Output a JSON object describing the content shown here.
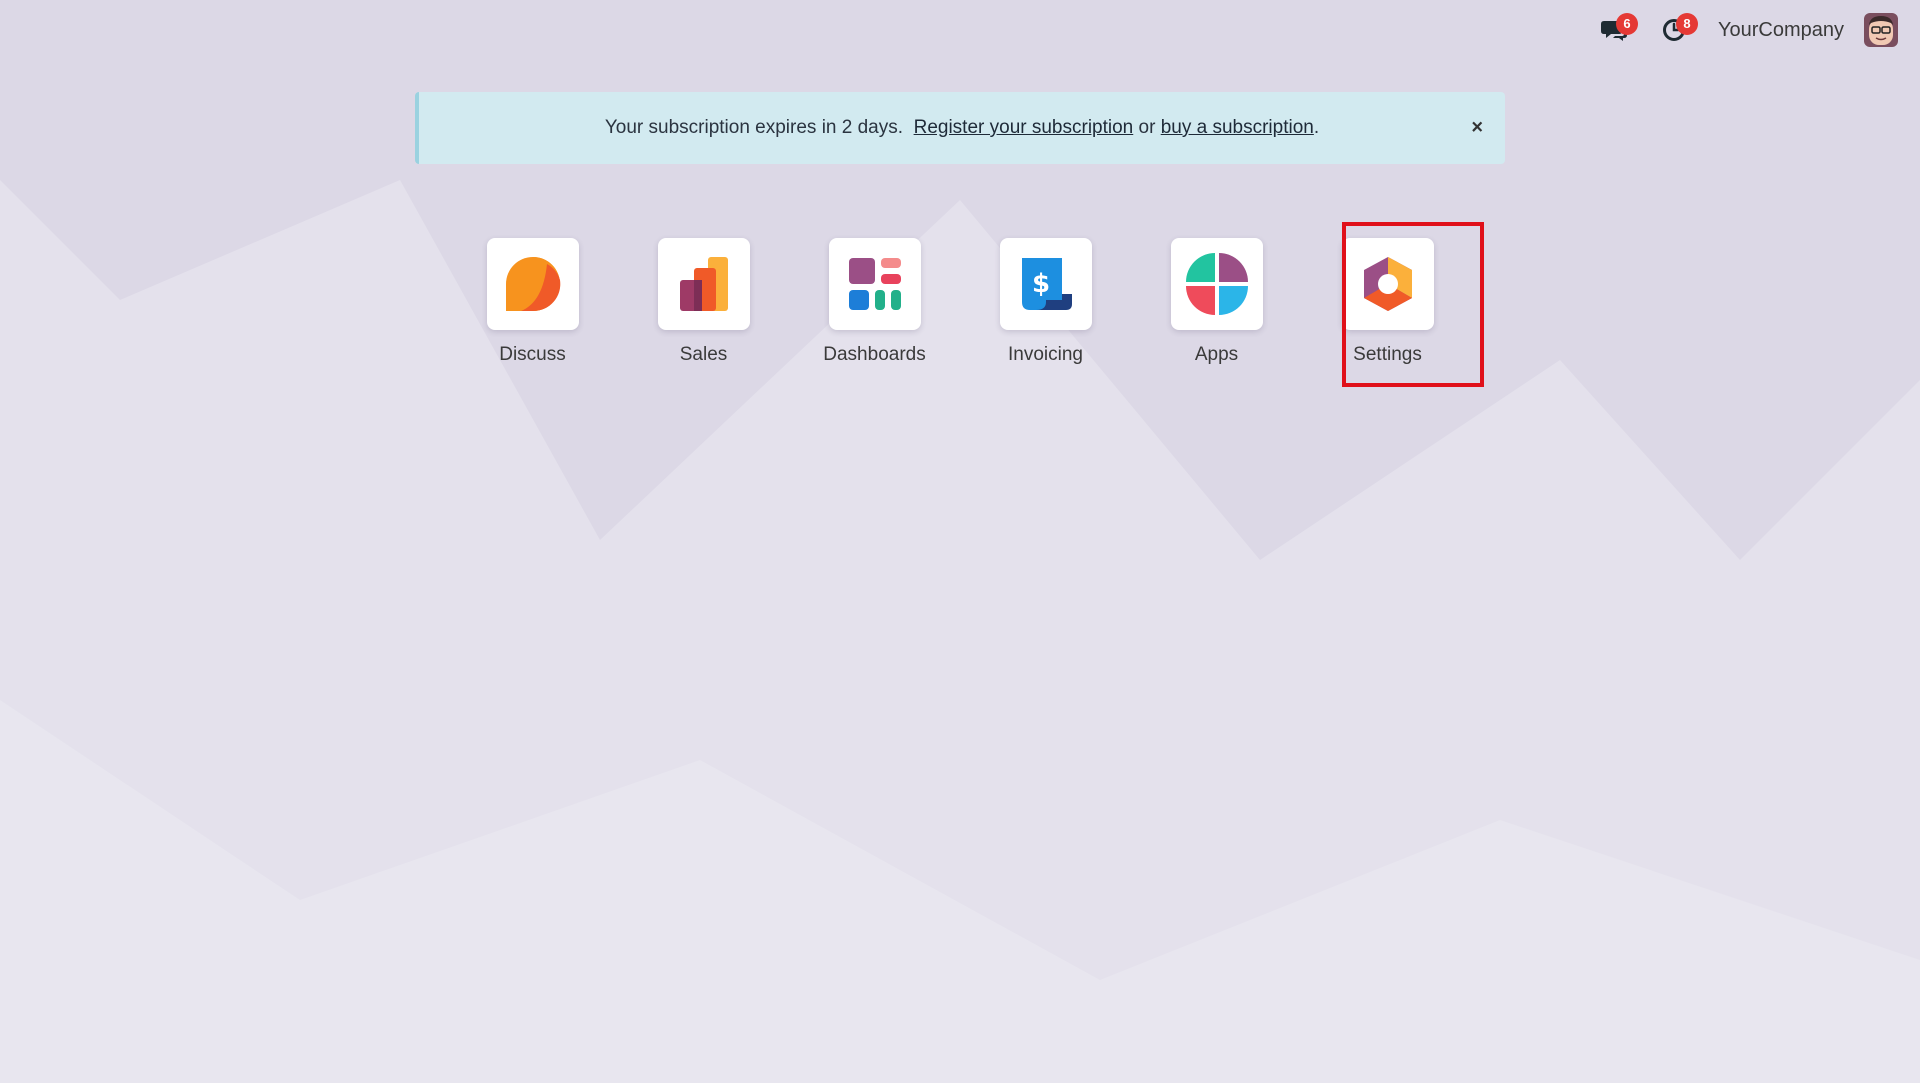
{
  "systray": {
    "messages_badge": "6",
    "activities_badge": "8",
    "company_name": "YourCompany"
  },
  "banner": {
    "text_before": "Your subscription expires in 2 days. ",
    "register_link": "Register your subscription",
    "text_middle": " or ",
    "buy_link": "buy a subscription",
    "text_after": ".",
    "close_label": "×"
  },
  "apps": [
    {
      "label": "Discuss",
      "icon": "discuss-icon"
    },
    {
      "label": "Sales",
      "icon": "sales-icon"
    },
    {
      "label": "Dashboards",
      "icon": "dashboards-icon"
    },
    {
      "label": "Invoicing",
      "icon": "invoicing-icon"
    },
    {
      "label": "Apps",
      "icon": "apps-icon"
    },
    {
      "label": "Settings",
      "icon": "settings-icon"
    }
  ],
  "colors": {
    "background": "#dcd8e6",
    "banner_bg": "#d2eaf0",
    "badge": "#e53935",
    "highlight": "#e0101a"
  }
}
